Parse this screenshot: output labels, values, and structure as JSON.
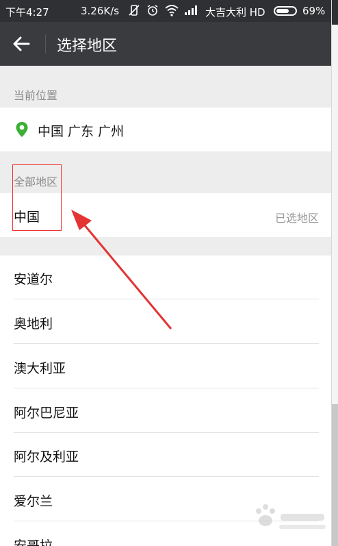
{
  "status_bar": {
    "time": "下午4:27",
    "speed": "3.26K/s",
    "carrier": "大吉大利 HD",
    "battery": "69%",
    "battery_level": 0.69
  },
  "header": {
    "title": "选择地区"
  },
  "current_location": {
    "label": "当前位置",
    "value": "中国 广东 广州"
  },
  "all_regions": {
    "label": "全部地区",
    "selected_country": "中国",
    "selected_badge": "已选地区"
  },
  "countries": [
    "安道尔",
    "奥地利",
    "澳大利亚",
    "阿尔巴尼亚",
    "阿尔及利亚",
    "爱尔兰",
    "安哥拉"
  ],
  "colors": {
    "status_bar": "#2f3033",
    "title_bar": "#3a3b3f",
    "pin": "#3cb034",
    "annotation": "#e33333"
  }
}
